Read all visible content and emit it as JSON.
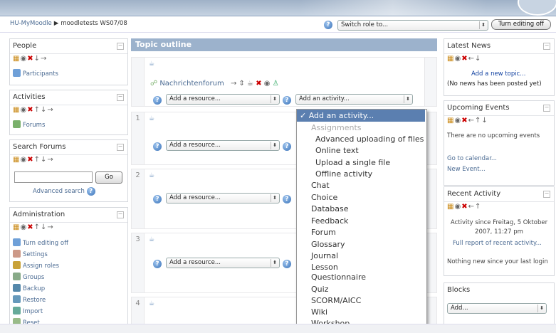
{
  "header": {
    "breadcrumb": [
      "HU-MyMoodle",
      "moodletests WS07/08"
    ],
    "breadcrumb_sep": "▶",
    "switch_role": "Switch role to...",
    "turn_editing_off": "Turn editing off"
  },
  "left": {
    "people": {
      "title": "People",
      "participants": "Participants"
    },
    "activities": {
      "title": "Activities",
      "forums": "Forums"
    },
    "search": {
      "title": "Search Forums",
      "go": "Go",
      "advanced": "Advanced search"
    },
    "admin": {
      "title": "Administration",
      "items": [
        "Turn editing off",
        "Settings",
        "Assign roles",
        "Groups",
        "Backup",
        "Restore",
        "Import",
        "Reset"
      ]
    }
  },
  "main": {
    "title": "Topic outline",
    "forum_link": "Nachrichtenforum",
    "add_resource": "Add a resource...",
    "add_activity": "Add an activity...",
    "sections": [
      "1",
      "2",
      "3",
      "4"
    ]
  },
  "dropdown": {
    "selected": "✓ Add an activity...",
    "group": "Assignments",
    "assignment_items": [
      "Advanced uploading of files",
      "Online text",
      "Upload a single file",
      "Offline activity"
    ],
    "items": [
      "Chat",
      "Choice",
      "Database",
      "Feedback",
      "Forum",
      "Glossary",
      "Journal",
      "Lesson",
      "Questionnaire",
      "Quiz",
      "SCORM/AICC",
      "Wiki",
      "Workshop"
    ]
  },
  "right": {
    "news": {
      "title": "Latest News",
      "add_topic": "Add a new topic...",
      "no_news": "(No news has been posted yet)"
    },
    "events": {
      "title": "Upcoming Events",
      "none": "There are no upcoming events",
      "calendar": "Go to calendar...",
      "new_event": "New Event..."
    },
    "activity": {
      "title": "Recent Activity",
      "since": "Activity since Freitag, 5 Oktober 2007, 11:27 pm",
      "full_report": "Full report of recent activity...",
      "nothing": "Nothing new since your last login"
    },
    "blocks": {
      "title": "Blocks",
      "add": "Add..."
    }
  },
  "colors": {
    "accent": "#5b7fb0",
    "header": "#9cb2cc",
    "link": "#4a6a92",
    "delete": "#cc0000"
  }
}
